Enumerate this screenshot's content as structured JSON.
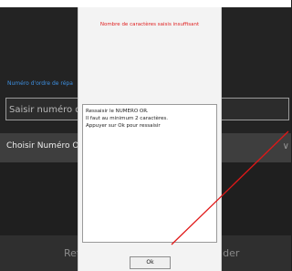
{
  "background_app": {
    "field_label": "Numéro d'ordre de répa",
    "input_placeholder": "Saisir numéro d'ord",
    "choose_label": "Choisir Numéro OR",
    "chevron_icon": "chevron-down-icon",
    "bottom_left_label": "Ret",
    "bottom_right_label": "lider"
  },
  "dialog": {
    "title": "Nombre de caractères saisis insuffisant",
    "title_color": "#e02020",
    "message_lines": [
      "Ressaisir le NUMERO OR.",
      "Il faut au minimum 2 caractères.",
      "Appuyer sur Ok pour ressaisir"
    ],
    "ok_label": "Ok"
  },
  "annotation": {
    "arrow_color": "#e01818"
  }
}
